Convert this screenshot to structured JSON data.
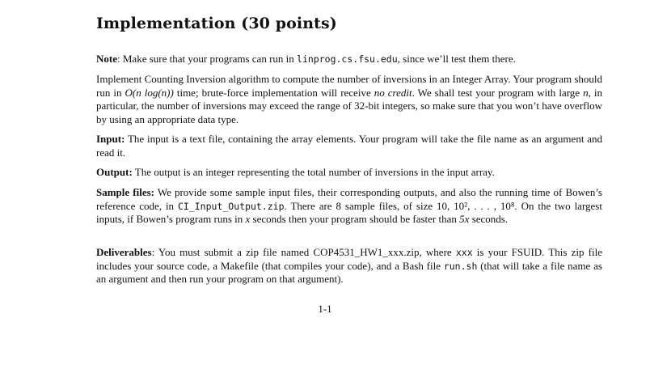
{
  "title": "Implementation (30 points)",
  "note": {
    "label": "Note",
    "text1": ": Make sure that your programs can run in ",
    "host": "linprog.cs.fsu.edu",
    "text2": ", since we’ll test them there."
  },
  "implementation": {
    "text1": "Implement Counting Inversion algorithm to compute the number of inversions in an Integer Array. Your program should run in ",
    "complexity": "O(n log(n))",
    "text2": " time; brute-force implementation will receive ",
    "no_credit": "no credit",
    "text3": ". We shall test your program with large ",
    "n": "n",
    "text4": ", in particular, the number of inversions may exceed the range of 32-bit integers, so make sure that you won’t have overflow by using an appropriate data type."
  },
  "input": {
    "label": "Input:",
    "text": " The input is a text file, containing the array elements. Your program will take the file name as an argument and read it."
  },
  "output": {
    "label": "Output:",
    "text": " The output is an integer representing the total number of inversions in the input array."
  },
  "sample_files": {
    "label": "Sample files:",
    "text1": " We provide some sample input files, their corresponding outputs, and also the running time of Bowen’s reference code, in ",
    "archive": "CI_Input_Output.zip",
    "text2": ". There are 8 sample files, of size ",
    "sizes": "10, 10², . . . , 10⁸",
    "text3": ". On the two largest inputs, if Bowen’s program runs in ",
    "x": "x",
    "text4": " seconds then your program should be faster than ",
    "fivex": "5x",
    "text5": " seconds."
  },
  "deliverables": {
    "label": "Deliverables",
    "text1": ": You must submit a zip file named COP4531_HW1_xxx.zip, where ",
    "xxx": "xxx",
    "text2": " is your FSUID. This zip file includes your source code, a Makefile (that compiles your code), and a Bash file ",
    "script": "run.sh",
    "text3": " (that will take a file name as an argument and then run your program on that argument)."
  },
  "page_number": "1-1"
}
